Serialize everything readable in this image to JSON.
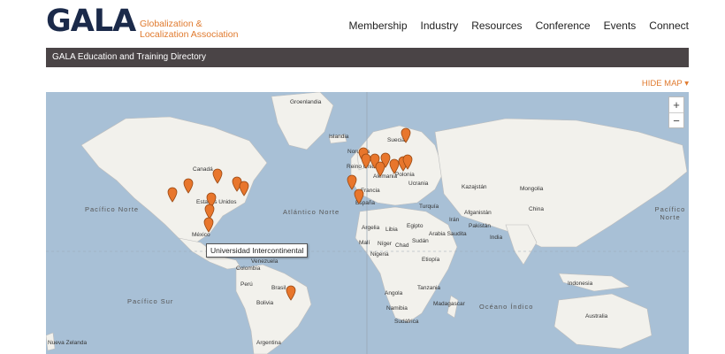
{
  "brand": {
    "logo": "GALA",
    "tagline_line1": "Globalization &",
    "tagline_line2": "Localization Association"
  },
  "nav": {
    "items": [
      "Membership",
      "Industry",
      "Resources",
      "Conference",
      "Events",
      "Connect"
    ]
  },
  "directory_bar": {
    "title": "GALA Education and Training Directory"
  },
  "map_controls": {
    "hide_map": "HIDE MAP ▾",
    "zoom_in": "+",
    "zoom_out": "−"
  },
  "map": {
    "tooltip": "Universidad Intercontinental",
    "labels": {
      "groenlandia": "Groenlandia",
      "islandia": "Islandia",
      "suecia": "Suecia",
      "noruega": "Noruega",
      "canada": "Canadá",
      "reino_unido": "Reino Unido",
      "alemania": "Alemania",
      "polonia": "Polonia",
      "ucrania": "Ucrania",
      "francia": "Francia",
      "kazajstan": "Kazajstán",
      "mongolia": "Mongolia",
      "china": "China",
      "estados_unidos": "Estados Unidos",
      "espana": "España",
      "turquia": "Turquía",
      "iran": "Irán",
      "afganistan": "Afganistán",
      "pakistan": "Pakistán",
      "argelia": "Argelia",
      "libia": "Libia",
      "egipto": "Egipto",
      "arabia_saudita": "Arabia Saudita",
      "india": "India",
      "mexico": "México",
      "mali": "Malí",
      "niger": "Níger",
      "chad": "Chad",
      "sudan": "Sudán",
      "etiopia": "Etiopía",
      "nigeria": "Nigeria",
      "venezuela": "Venezuela",
      "colombia": "Colombia",
      "peru": "Perú",
      "brasil": "Brasil",
      "bolivia": "Bolivia",
      "indonesia": "Indonesia",
      "angola": "Angola",
      "tanzania": "Tanzania",
      "namibia": "Namibia",
      "madagascar": "Madagascar",
      "sudafrica": "Sudáfrica",
      "australia": "Australia",
      "argentina": "Argentina",
      "nueva_zelanda": "Nueva Zelanda"
    },
    "oceans": {
      "pacifico_norte_1": "Pacífico Norte",
      "pacifico_norte_2": "Pacífico Norte",
      "atlantico_norte": "Atlántico Norte",
      "pacifico_sur": "Pacífico Sur",
      "oceano_indico": "Océano Índico"
    }
  }
}
